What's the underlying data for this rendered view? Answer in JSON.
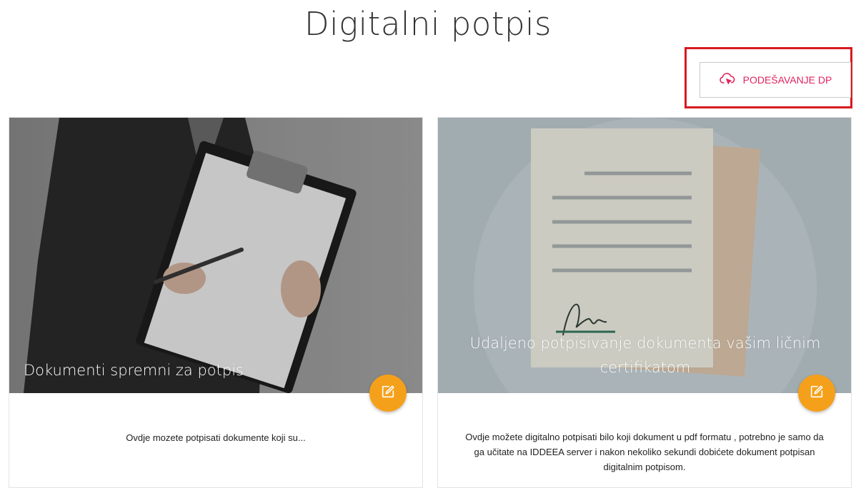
{
  "page": {
    "title": "Digitalni potpis"
  },
  "toolbar": {
    "dp_settings_label": "PODEŠAVANJE DP",
    "dp_settings_icon": "cloud-pointer-icon"
  },
  "colors": {
    "accent_pink": "#e0245e",
    "highlight_red": "#d71920",
    "fab_orange": "#f5a01a"
  },
  "cards": [
    {
      "title": "Dokumenti spremni za potpis",
      "description": "Ovdje mozete potpisati dokumente koji su...",
      "action_icon": "edit-icon"
    },
    {
      "title": "Udaljeno potpisivanje dokumenta vašim ličnim certifikatom",
      "description": "Ovdje možete digitalno potpisati bilo koji dokument u pdf formatu , potrebno je samo da ga učitate na IDDEEA server i nakon nekoliko sekundi dobićete dokument potpisan digitalnim potpisom.",
      "action_icon": "edit-icon"
    }
  ]
}
